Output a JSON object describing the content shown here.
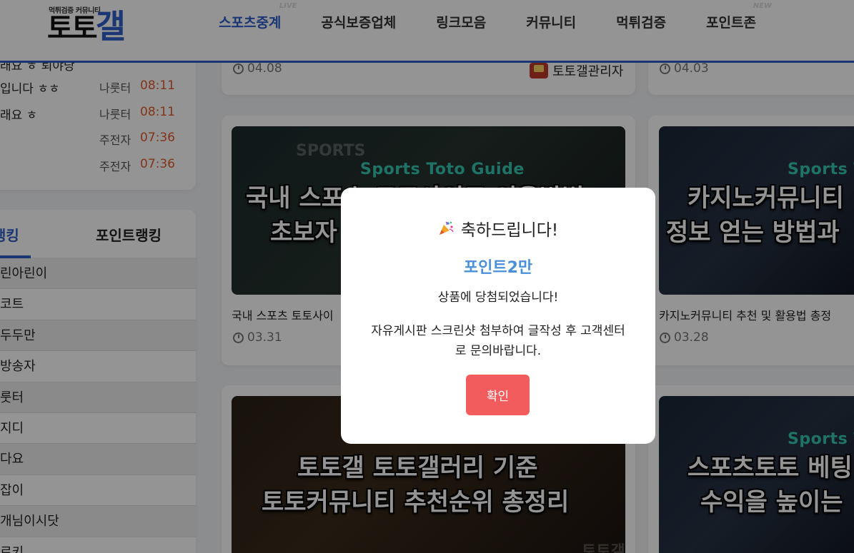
{
  "header": {
    "logo_tagline": "먹튀검증 커뮤니티",
    "logo_text_a": "토토",
    "logo_text_b": "갤",
    "nav": [
      {
        "label": "스포츠중계",
        "badge": "LIVE"
      },
      {
        "label": "공식보증업체",
        "badge": ""
      },
      {
        "label": "링크모음",
        "badge": ""
      },
      {
        "label": "커뮤니티",
        "badge": ""
      },
      {
        "label": "먹튀검증",
        "badge": ""
      },
      {
        "label": "포인트존",
        "badge": "NEW"
      }
    ]
  },
  "recent_posts": [
    {
      "title": "래요 ㅎ 퇴야당",
      "author": "",
      "time": ""
    },
    {
      "title": "입니다 ㅎㅎ",
      "author": "나룻터",
      "time": "08:11"
    },
    {
      "title": "래요 ㅎ",
      "author": "나룻터",
      "time": "08:11"
    },
    {
      "title": "",
      "author": "주전자",
      "time": "07:36"
    },
    {
      "title": "",
      "author": "주전자",
      "time": "07:36"
    }
  ],
  "ranking": {
    "tab_active": "랭킹",
    "tab_other": "포인트랭킹",
    "items": [
      "린아린이",
      "코트",
      "두두만",
      "방송자",
      "룻터",
      "지디",
      "다요",
      "잡이",
      "개님이시닷",
      "로키"
    ]
  },
  "posts": {
    "top_left_date": "04.08",
    "top_left_author": "토토갤관리자",
    "top_right_date": "04.03",
    "card1": {
      "label": "Sports Toto Guide",
      "watermark": "SPORTS",
      "thumb_line1": "국내 스포츠 토토사이트 이용방법",
      "thumb_line2": "초보자",
      "title": "국내 스포츠 토토사이",
      "date": "03.31"
    },
    "card2": {
      "label": "Sports T",
      "thumb_line1": "카지노커뮤니티",
      "thumb_line2": "정보 얻는 방법과",
      "title": "카지노커뮤니티 추천 및 활용법 총정",
      "date": "03.28"
    },
    "card3": {
      "thumb_line1": "토토갤 토토갤러리 기준",
      "thumb_line2": "토토커뮤니티 추천순위 총정리",
      "watermark": "토토갤"
    },
    "card4": {
      "label": "Sports T",
      "thumb_line1": "스포츠토토 베팅",
      "thumb_line2": "수익을 높이는"
    }
  },
  "modal": {
    "heading": "축하드립니다!",
    "prize": "포인트2만",
    "message": "상품에 당첨되었습니다!",
    "instruction": "자유게시판 스크린샷 첨부하여 글작성 후 고객센터로 문의바랍니다.",
    "confirm_label": "확인"
  }
}
